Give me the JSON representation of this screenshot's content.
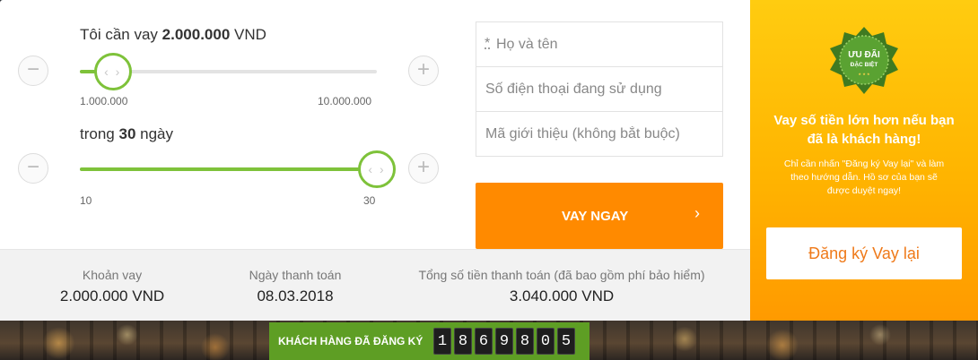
{
  "loan_amount": {
    "prefix": "Tôi cần vay",
    "value": "2.000.000",
    "unit": "VND",
    "min_label": "1.000.000",
    "max_label": "10.000.000",
    "slider_position": 0.111,
    "minus_icon": "−",
    "plus_icon": "+"
  },
  "term": {
    "prefix": "trong",
    "value": "30",
    "unit": "ngày",
    "min_label": "10",
    "max_label": "30",
    "slider_position": 1.0,
    "minus_icon": "−",
    "plus_icon": "+"
  },
  "slider_knob_glyph": "‹ ›",
  "form": {
    "required_mark": "*",
    "full_name_placeholder": "Họ và tên",
    "phone_placeholder": "Số điện thoại đang sử dụng",
    "referral_placeholder": "Mã giới thiệu (không bắt buộc)"
  },
  "cta": {
    "label": "VAY NGAY",
    "chevron": "›"
  },
  "summary": {
    "loan_label": "Khoản vay",
    "loan_value": "2.000.000 VND",
    "due_label": "Ngày thanh toán",
    "due_value": "08.03.2018",
    "total_label": "Tổng số tiền thanh toán (đã bao gồm phí bảo hiểm)",
    "total_value": "3.040.000 VND"
  },
  "promo": {
    "badge_line1": "ƯU ĐÃI",
    "badge_line2": "ĐẶC BIỆT",
    "badge_stars": "★ ★ ★",
    "title": "Vay số tiền lớn hơn nếu bạn đã là khách hàng!",
    "description": "Chỉ cần nhấn \"Đăng ký Vay lại\" và làm theo hướng dẫn. Hồ sơ của bạn sẽ được duyệt ngay!",
    "button_label": "Đăng ký Vay lại"
  },
  "counter": {
    "label": "KHÁCH HÀNG ĐÃ ĐĂNG KÝ",
    "digits": [
      "1",
      "8",
      "6",
      "9",
      "8",
      "0",
      "5"
    ]
  },
  "colors": {
    "accent_green": "#7ec23a",
    "cta_orange": "#ff8a00",
    "promo_yellow": "#ffcc10",
    "counter_green": "#5e9e24"
  }
}
